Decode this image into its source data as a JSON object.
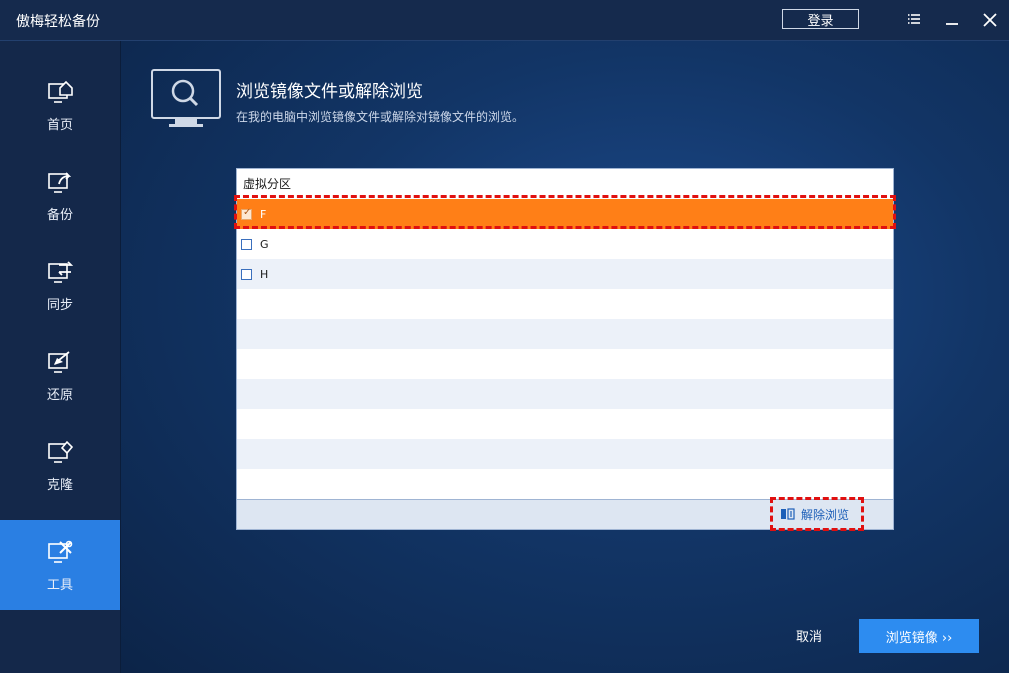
{
  "app": {
    "title": "傲梅轻松备份"
  },
  "titlebar": {
    "login_label": "登录",
    "menu_icon": "menu-icon",
    "minimize_icon": "minimize-icon",
    "close_icon": "close-icon"
  },
  "sidebar": {
    "items": [
      {
        "label": "首页",
        "icon": "home-icon",
        "active": false
      },
      {
        "label": "备份",
        "icon": "backup-icon",
        "active": false
      },
      {
        "label": "同步",
        "icon": "sync-icon",
        "active": false
      },
      {
        "label": "还原",
        "icon": "restore-icon",
        "active": false
      },
      {
        "label": "克隆",
        "icon": "clone-icon",
        "active": false
      },
      {
        "label": "工具",
        "icon": "tools-icon",
        "active": true
      }
    ]
  },
  "main": {
    "title": "浏览镜像文件或解除浏览",
    "subtitle": "在我的电脑中浏览镜像文件或解除对镜像文件的浏览。",
    "table": {
      "header": "虚拟分区",
      "rows": [
        {
          "label": "F",
          "checked": true,
          "selected": true
        },
        {
          "label": "G",
          "checked": false,
          "selected": false
        },
        {
          "label": "H",
          "checked": false,
          "selected": false
        }
      ],
      "unmount_label": "解除浏览"
    },
    "cancel_label": "取消",
    "mount_label": "浏览镜像 ››"
  },
  "colors": {
    "accent": "#2d8cf0",
    "selected_row": "#ff7f17",
    "highlight": "#e01010",
    "sidebar_active": "#2a7fe3"
  }
}
